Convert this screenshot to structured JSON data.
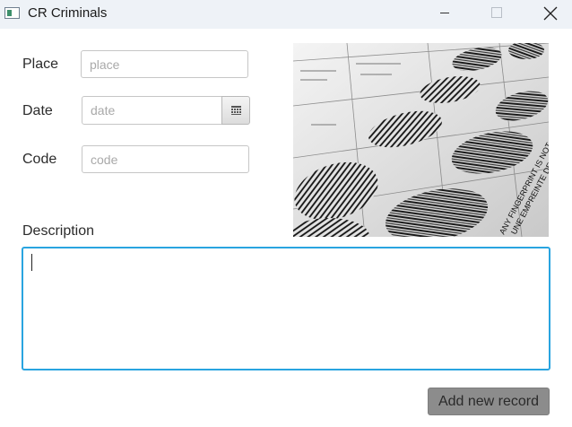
{
  "window": {
    "title": "CR Criminals",
    "icon": "app-window-icon",
    "controls": [
      "minimize-icon",
      "maximize-icon",
      "close-icon"
    ]
  },
  "form": {
    "place": {
      "label": "Place",
      "value": "",
      "placeholder": "place"
    },
    "date": {
      "label": "Date",
      "value": "",
      "placeholder": "date",
      "picker_icon": "calendar-icon"
    },
    "code": {
      "label": "Code",
      "value": "",
      "placeholder": "code"
    },
    "description": {
      "label": "Description",
      "value": ""
    }
  },
  "image": {
    "subject": "fingerprint card photo",
    "visible_text": "ANY FINGERPRINT IS NOT A UNE EMPREINTE DE",
    "text_line_1": "ANY FINGERPRINT IS NOT A",
    "text_line_2": "UNE EMPREINTE DE"
  },
  "actions": {
    "add_label": "Add new record"
  },
  "colors": {
    "titlebar_bg": "#eef2f7",
    "focus_border": "#29a4e0",
    "button_bg": "#8c8c8c"
  }
}
